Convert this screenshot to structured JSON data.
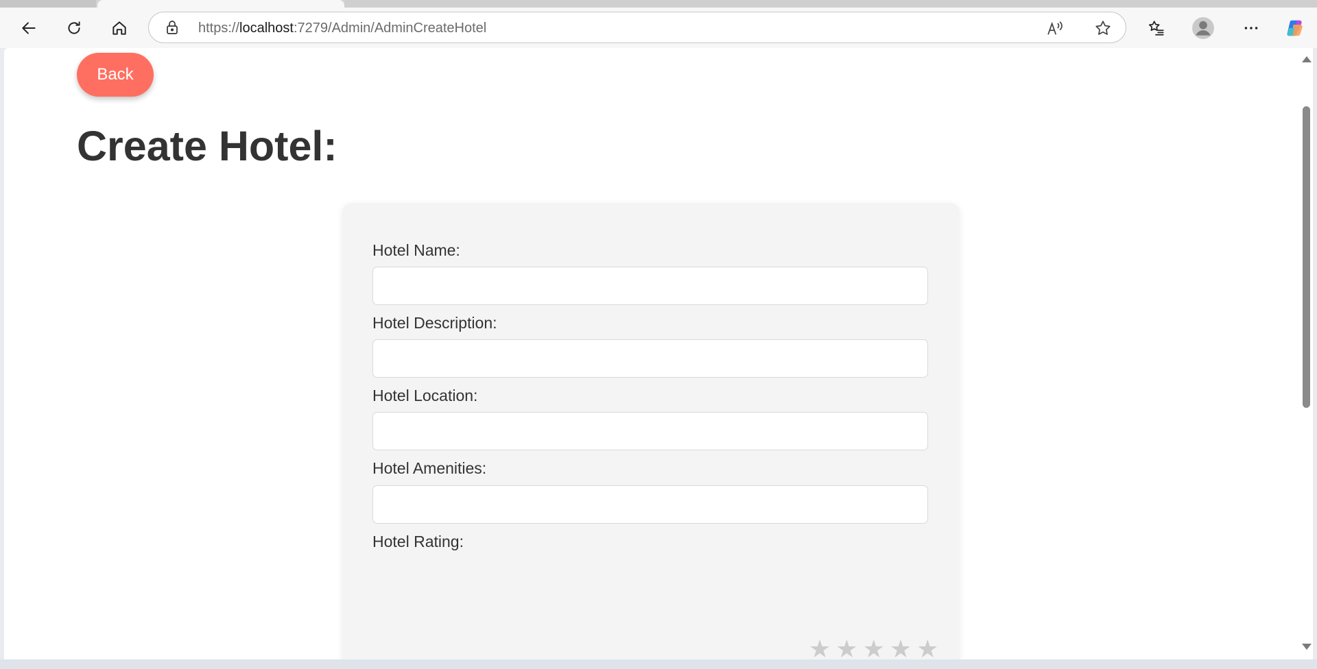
{
  "browser": {
    "url_prefix": "https://",
    "url_host": "localhost",
    "url_rest": ":7279/Admin/AdminCreateHotel",
    "icons": [
      "back-arrow-icon",
      "refresh-icon",
      "home-icon",
      "lock-icon",
      "read-aloud-icon",
      "favorite-star-icon",
      "favorites-list-icon",
      "profile-avatar-icon",
      "more-dots-icon",
      "copilot-icon"
    ]
  },
  "page": {
    "back_label": "Back",
    "title": "Create Hotel:",
    "accent_color": "#ff6f61"
  },
  "form": {
    "fields": [
      {
        "label": "Hotel Name:",
        "value": "",
        "placeholder": ""
      },
      {
        "label": "Hotel Description:",
        "value": "",
        "placeholder": ""
      },
      {
        "label": "Hotel Location:",
        "value": "",
        "placeholder": ""
      },
      {
        "label": "Hotel Amenities:",
        "value": "",
        "placeholder": ""
      }
    ],
    "rating_label": "Hotel Rating:",
    "rating": {
      "stars": [
        "★",
        "★",
        "★",
        "★",
        "★"
      ],
      "selected": 0,
      "max": 5,
      "empty_color": "#cccccc"
    }
  }
}
